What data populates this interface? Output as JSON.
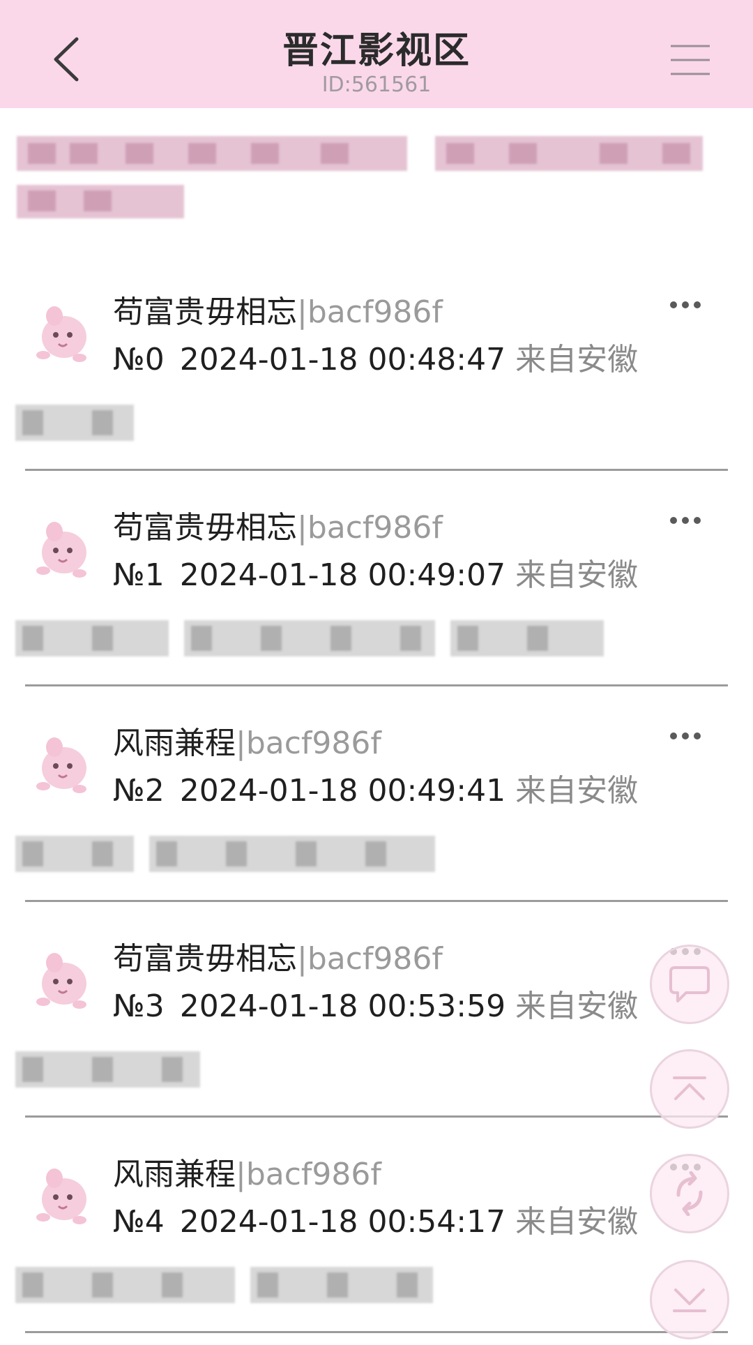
{
  "header": {
    "title": "晋江影视区",
    "subtitle": "ID:561561"
  },
  "posts": [
    {
      "author": "苟富贵毋相忘",
      "user_id": "|bacf986f",
      "floor": "№0",
      "time": "2024-01-18 00:48:47",
      "location": "来自安徽"
    },
    {
      "author": "苟富贵毋相忘",
      "user_id": "|bacf986f",
      "floor": "№1",
      "time": "2024-01-18 00:49:07",
      "location": "来自安徽"
    },
    {
      "author": "风雨兼程",
      "user_id": "|bacf986f",
      "floor": "№2",
      "time": "2024-01-18 00:49:41",
      "location": "来自安徽"
    },
    {
      "author": "苟富贵毋相忘",
      "user_id": "|bacf986f",
      "floor": "№3",
      "time": "2024-01-18 00:53:59",
      "location": "来自安徽"
    },
    {
      "author": "风雨兼程",
      "user_id": "|bacf986f",
      "floor": "№4",
      "time": "2024-01-18 00:54:17",
      "location": "来自安徽"
    }
  ],
  "fab_icons": [
    "comment-icon",
    "scroll-top-icon",
    "refresh-icon",
    "scroll-bottom-icon"
  ],
  "colors": {
    "header_bg": "#fad8ea",
    "accent_pink": "#f2c9dd",
    "muted_text": "#9a9a9a"
  }
}
